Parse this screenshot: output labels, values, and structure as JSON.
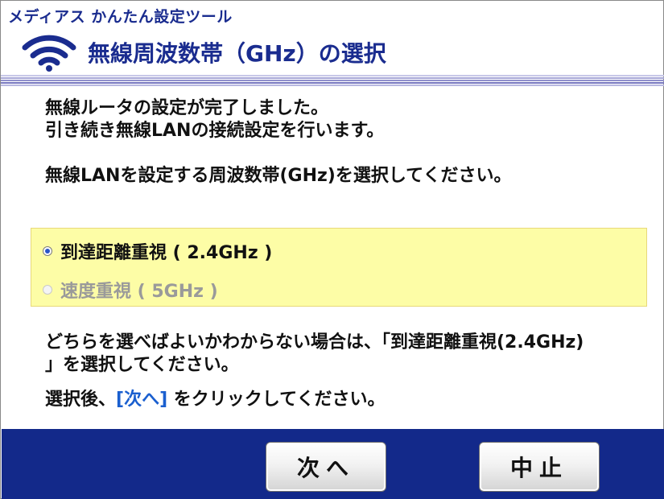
{
  "app": {
    "title": "メディアス かんたん設定ツール"
  },
  "header": {
    "title": "無線周波数帯（GHz）の選択",
    "icon": "wifi-icon"
  },
  "messages": {
    "line1": "無線ルータの設定が完了しました。",
    "line2": "引き続き無線LANの接続設定を行います。",
    "prompt": "無線LANを設定する周波数帯(GHz)を選択してください。"
  },
  "options": [
    {
      "label": "到達距離重視 ( 2.4GHz )",
      "selected": true,
      "enabled": true
    },
    {
      "label": "速度重視 ( 5GHz )",
      "selected": false,
      "enabled": false
    }
  ],
  "note": {
    "line1": "どちらを選べばよいかわからない場合は、「到達距離重視(2.4GHz)",
    "line2": "」を選択してください。"
  },
  "instruction": {
    "prefix": "選択後、",
    "link": "[次へ]",
    "suffix": " をクリックしてください。"
  },
  "buttons": {
    "next": "次へ",
    "cancel": "中止"
  },
  "colors": {
    "brand": "#1a2c8f",
    "footer": "#13298a",
    "option_bg": "#fdfda6",
    "link": "#1a5fcf"
  }
}
